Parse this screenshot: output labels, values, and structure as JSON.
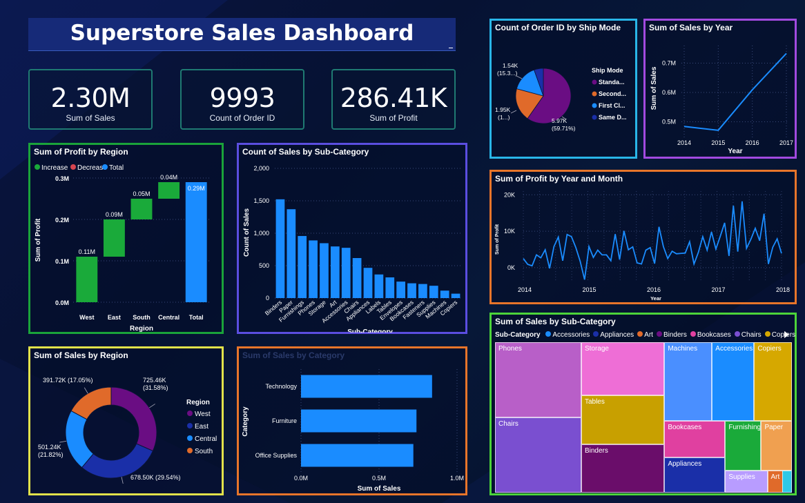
{
  "dashboard": {
    "title": "Superstore Sales Dashboard"
  },
  "kpis": [
    {
      "value": "2.30M",
      "label": "Sum of Sales"
    },
    {
      "value": "9993",
      "label": "Count of Order ID"
    },
    {
      "value": "286.41K",
      "label": "Sum of Profit"
    }
  ],
  "colors": {
    "increase": "#1aaa3a",
    "decrease": "#d64550",
    "total": "#1a8cff",
    "bar": "#1a8cff"
  },
  "chart_data": [
    {
      "id": "profit_by_region",
      "type": "bar",
      "subtype": "waterfall",
      "title": "Sum of Profit by Region",
      "xlabel": "Region",
      "ylabel": "Sum of Profit",
      "legend": [
        "Increase",
        "Decrease",
        "Total"
      ],
      "categories": [
        "West",
        "East",
        "South",
        "Central",
        "Total"
      ],
      "values": [
        0.11,
        0.09,
        0.05,
        0.04,
        0.29
      ],
      "labels": [
        "0.11M",
        "0.09M",
        "0.05M",
        "0.04M",
        "0.29M"
      ],
      "yticks": [
        "0.0M",
        "0.1M",
        "0.2M",
        "0.3M"
      ],
      "ylim": [
        0,
        0.3
      ]
    },
    {
      "id": "count_sales_by_subcategory",
      "type": "bar",
      "title": "Count of Sales by Sub-Category",
      "xlabel": "Sub-Category",
      "ylabel": "Count of Sales",
      "categories": [
        "Binders",
        "Paper",
        "Furnishings",
        "Phones",
        "Storage",
        "Art",
        "Accessories",
        "Chairs",
        "Appliances",
        "Labels",
        "Tables",
        "Envelopes",
        "Bookcases",
        "Fasteners",
        "Supplies",
        "Machines",
        "Copiers"
      ],
      "values": [
        1523,
        1370,
        957,
        889,
        846,
        796,
        775,
        617,
        466,
        364,
        319,
        254,
        228,
        217,
        190,
        115,
        68
      ],
      "yticks": [
        "0",
        "500",
        "1,000",
        "1,500",
        "2,000"
      ],
      "ylim": [
        0,
        2000
      ]
    },
    {
      "id": "sales_by_region",
      "type": "pie",
      "subtype": "donut",
      "title": "Sum of Sales by Region",
      "legend_title": "Region",
      "categories": [
        "West",
        "East",
        "Central",
        "South"
      ],
      "values": [
        725.46,
        678.5,
        501.24,
        391.72
      ],
      "labels": [
        "725.46K (31.58%)",
        "678.50K (29.54%)",
        "501.24K (21.82%)",
        "391.72K (17.05%)"
      ],
      "colors": [
        "#6a0d83",
        "#1a2fa8",
        "#1a8cff",
        "#e06a2a"
      ]
    },
    {
      "id": "sales_by_category",
      "type": "bar",
      "orientation": "horizontal",
      "title": "Sum of Sales by Category",
      "xlabel": "Sum of Sales",
      "ylabel": "Category",
      "categories": [
        "Technology",
        "Furniture",
        "Office Supplies"
      ],
      "values": [
        0.84,
        0.74,
        0.72
      ],
      "xticks": [
        "0.0M",
        "0.5M",
        "1.0M"
      ],
      "xlim": [
        0,
        1.0
      ]
    },
    {
      "id": "orders_by_ship_mode",
      "type": "pie",
      "title": "Count of Order ID by Ship Mode",
      "legend_title": "Ship Mode",
      "categories": [
        "Standa...",
        "Second...",
        "First Cl...",
        "Same D..."
      ],
      "values": [
        5968,
        1945,
        1538,
        543
      ],
      "labels": [
        "5.97K (59.71%)",
        "1.95K (1...)",
        "1.54K (15.3...)",
        ""
      ],
      "colors": [
        "#6a0d83",
        "#e06a2a",
        "#1a8cff",
        "#1a2fa8"
      ]
    },
    {
      "id": "sales_by_year",
      "type": "line",
      "title": "Sum of Sales by Year",
      "xlabel": "Year",
      "ylabel": "Sum of Sales",
      "x": [
        2014,
        2015,
        2016,
        2017
      ],
      "values": [
        0.484,
        0.471,
        0.609,
        0.733
      ],
      "xticks": [
        "2014",
        "2015",
        "2016",
        "2017"
      ],
      "yticks": [
        "0.5M",
        "0.6M",
        "0.7M"
      ],
      "ylim": [
        0.44,
        0.76
      ]
    },
    {
      "id": "profit_by_year_month",
      "type": "line",
      "title": "Sum of Profit by Year and Month",
      "xlabel": "Year",
      "ylabel": "Sum of Profit",
      "values": [
        2.5,
        0.9,
        0.5,
        3.5,
        2.7,
        4.9,
        -0.2,
        5.8,
        8.4,
        1.9,
        9.1,
        8.5,
        5.5,
        1.7,
        -3.3,
        5.8,
        2.8,
        4.8,
        3.5,
        3.5,
        1.9,
        9.2,
        2.2,
        10.1,
        4.9,
        5.7,
        1.3,
        1.0,
        4.8,
        5.5,
        1.1,
        11.2,
        5.8,
        2.5,
        4.5,
        3.8,
        3.9,
        4.0,
        7.1,
        1.0,
        4.2,
        8.5,
        4.8,
        9.8,
        5.1,
        8.6,
        12.3,
        3.2,
        17.0,
        4.4,
        18.2,
        5.3,
        7.8,
        10.8,
        7.4,
        14.8,
        1.0,
        5.6,
        7.9,
        3.9
      ],
      "xticks": [
        "2014",
        "2015",
        "2016",
        "2017",
        "2018"
      ],
      "yticks": [
        "0K",
        "10K",
        "20K"
      ],
      "ylim": [
        -4,
        21
      ]
    },
    {
      "id": "sales_by_subcategory",
      "type": "treemap",
      "title": "Sum of Sales by Sub-Category",
      "legend_title": "Sub-Category",
      "legend": [
        "Accessories",
        "Appliances",
        "Art",
        "Binders",
        "Bookcases",
        "Chairs",
        "Copiers"
      ],
      "legend_colors": [
        "#1a8cff",
        "#1a2fa8",
        "#e06a2a",
        "#6a0d83",
        "#e040a0",
        "#7a4fd0",
        "#d6a800"
      ],
      "categories": [
        "Phones",
        "Chairs",
        "Storage",
        "Tables",
        "Binders",
        "Machines",
        "Bookcases",
        "Appliances",
        "Accessories",
        "Copiers",
        "Furnishings",
        "Paper",
        "Supplies",
        "Art"
      ],
      "values": [
        330.0,
        328.4,
        223.8,
        206.9,
        203.4,
        189.2,
        114.9,
        107.5,
        167.4,
        150.0,
        91.7,
        78.5,
        46.7,
        27.1
      ]
    }
  ],
  "treemap_labels": {
    "Phones": "Phones",
    "Chairs": "Chairs",
    "Storage": "Storage",
    "Tables": "Tables",
    "Binders": "Binders",
    "Machines": "Machines",
    "Bookcases": "Bookcases",
    "Appliances": "Appliances",
    "Accessories": "Accessories",
    "Copiers": "Copiers",
    "Furnishings": "Furnishings",
    "Paper": "Paper",
    "Supplies": "Supplies",
    "Art": "Art"
  }
}
